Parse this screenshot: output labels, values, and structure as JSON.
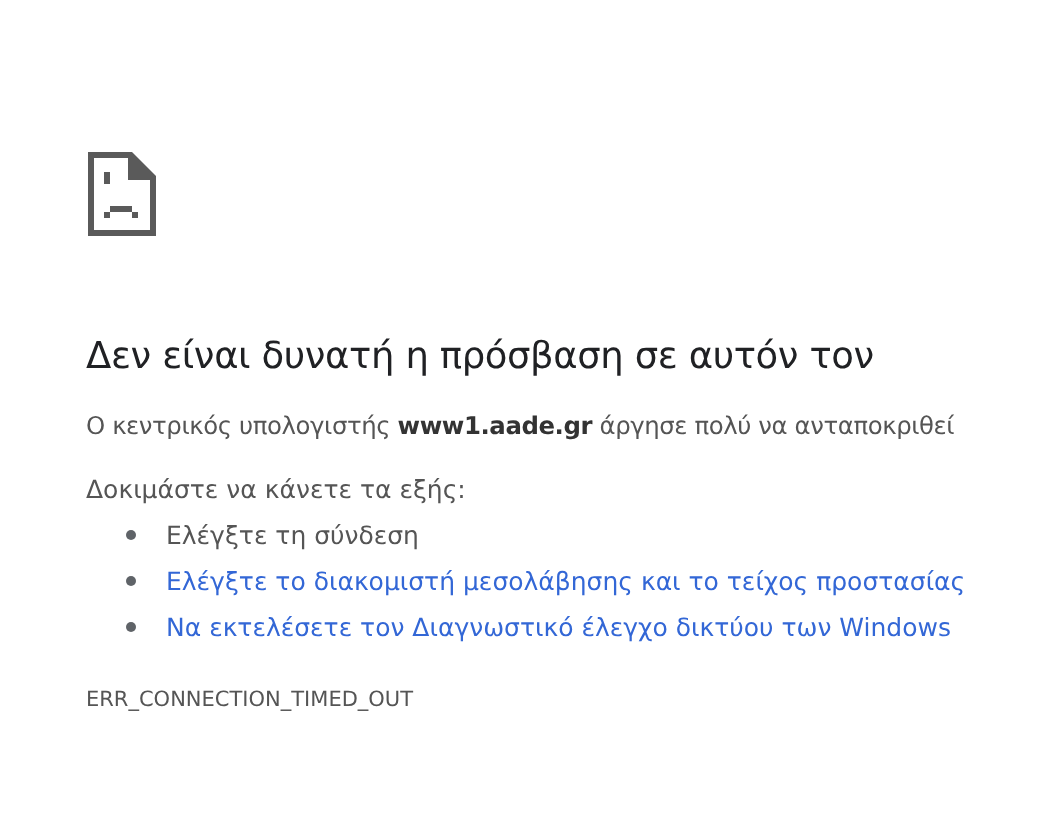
{
  "heading": "Δεν είναι δυνατή η πρόσβαση σε αυτόν τον",
  "message": "Ο κεντρικός υπολογιστής **www1.aade.gr** άργησε πολύ να ανταποκριθεί",
  "suggestions_title": "Δοκιμάστε να κάνετε τα εξής:",
  "suggestions": [
    {
      "text": "Ελέγξτε τη σύνδεση",
      "link": false
    },
    {
      "text": "Ελέγξτε το διακομιστή μεσολάβησης και το τείχος προστασίας",
      "link": true
    },
    {
      "text": "Να εκτελέσετε τον Διαγνωστικό έλεγχο δικτύου των Windows",
      "link": true
    }
  ],
  "error_code": "ERR_CONNECTION_TIMED_OUT"
}
